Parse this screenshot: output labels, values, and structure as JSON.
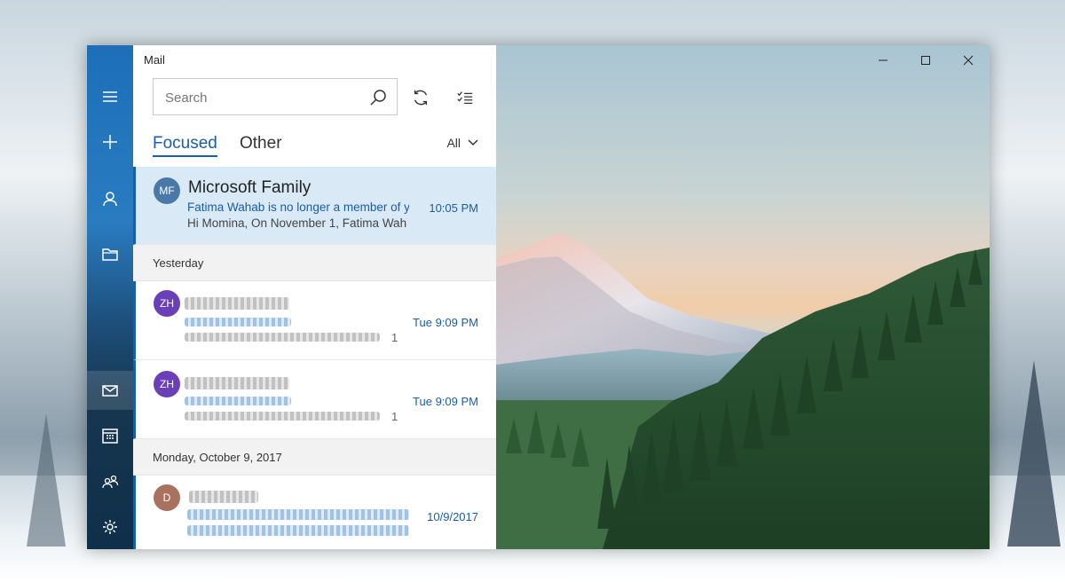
{
  "app": {
    "title": "Mail"
  },
  "rail": {
    "items": [
      {
        "name": "menu-icon"
      },
      {
        "name": "new-mail-icon"
      },
      {
        "name": "account-icon"
      },
      {
        "name": "folders-icon"
      },
      {
        "name": "mail-icon"
      },
      {
        "name": "calendar-icon"
      },
      {
        "name": "people-icon"
      },
      {
        "name": "settings-icon"
      }
    ]
  },
  "search": {
    "placeholder": "Search",
    "value": ""
  },
  "tabs": {
    "focused": "Focused",
    "other": "Other",
    "filter": "All"
  },
  "messages": {
    "first": {
      "initials": "MF",
      "sender": "Microsoft Family",
      "subject": "Fatima Wahab is no longer a member of y",
      "preview": "Hi Momina,  On November 1, Fatima Wah",
      "time": "10:05 PM",
      "avatar_color": "#4a79a8"
    },
    "group_yesterday": "Yesterday",
    "second": {
      "initials": "ZH",
      "time": "Tue 9:09 PM",
      "trailing": "1",
      "avatar_color": "#6a3fb8"
    },
    "third": {
      "initials": "ZH",
      "time": "Tue 9:09 PM",
      "trailing": "1",
      "avatar_color": "#6a3fb8"
    },
    "group_monday": "Monday, October 9, 2017",
    "fourth": {
      "initials": "D",
      "time": "10/9/2017",
      "avatar_color": "#a8725e"
    }
  },
  "colors": {
    "accent": "#1a5da8",
    "selected_bg": "#d9e9f6"
  }
}
